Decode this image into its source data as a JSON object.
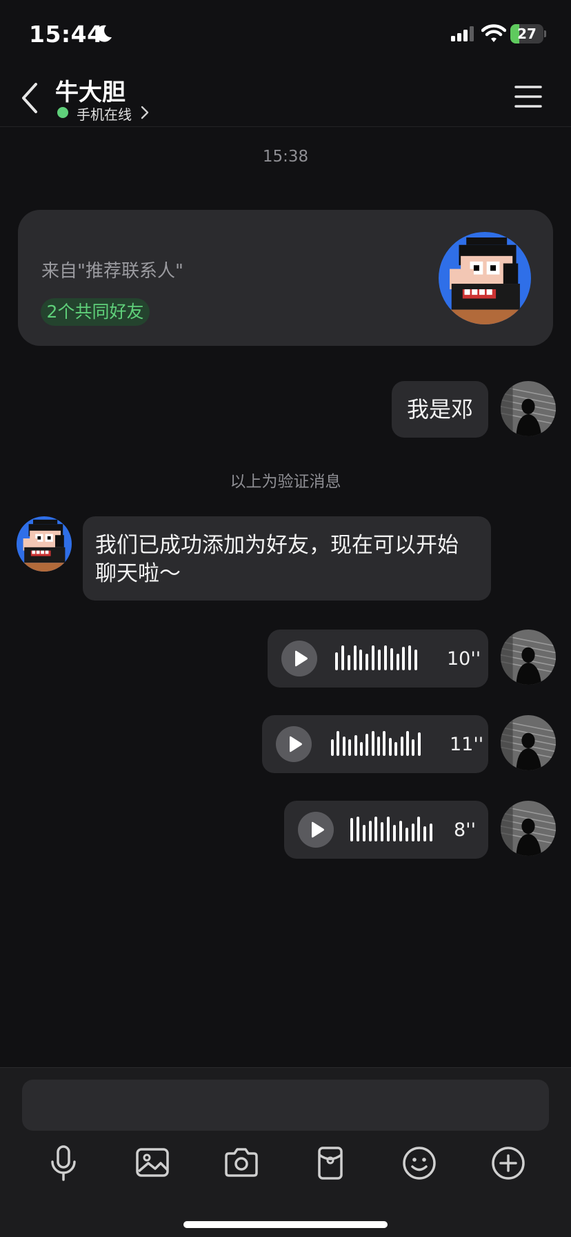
{
  "status_bar": {
    "time": "15:44",
    "battery": "27",
    "battery_level": 0.27,
    "icons": [
      "moon-icon",
      "signal-icon",
      "wifi-icon",
      "battery-icon"
    ]
  },
  "header": {
    "contact_name": "牛大胆",
    "online_status": "手机在线"
  },
  "chat": {
    "timestamp": "15:38",
    "friend_card": {
      "source": "来自\"推荐联系人\"",
      "mutual_friends": "2个共同好友"
    },
    "messages": [
      {
        "type": "text",
        "direction": "outgoing",
        "text": "我是邓"
      },
      {
        "type": "text",
        "direction": "incoming",
        "text": "我们已成功添加为好友，现在可以开始聊天啦～"
      },
      {
        "type": "voice",
        "direction": "outgoing",
        "duration": "10''"
      },
      {
        "type": "voice",
        "direction": "outgoing",
        "duration": "11''"
      },
      {
        "type": "voice",
        "direction": "outgoing",
        "duration": "8''"
      }
    ],
    "verify_note": "以上为验证消息"
  },
  "input": {
    "placeholder": "",
    "toolbar": [
      "microphone-icon",
      "image-icon",
      "camera-icon",
      "red-packet-icon",
      "emoji-icon",
      "plus-icon"
    ]
  },
  "colors": {
    "background": "#111113",
    "bubble": "#2b2b2e",
    "online_green": "#5fd07a",
    "battery_green": "#5fca5e"
  }
}
